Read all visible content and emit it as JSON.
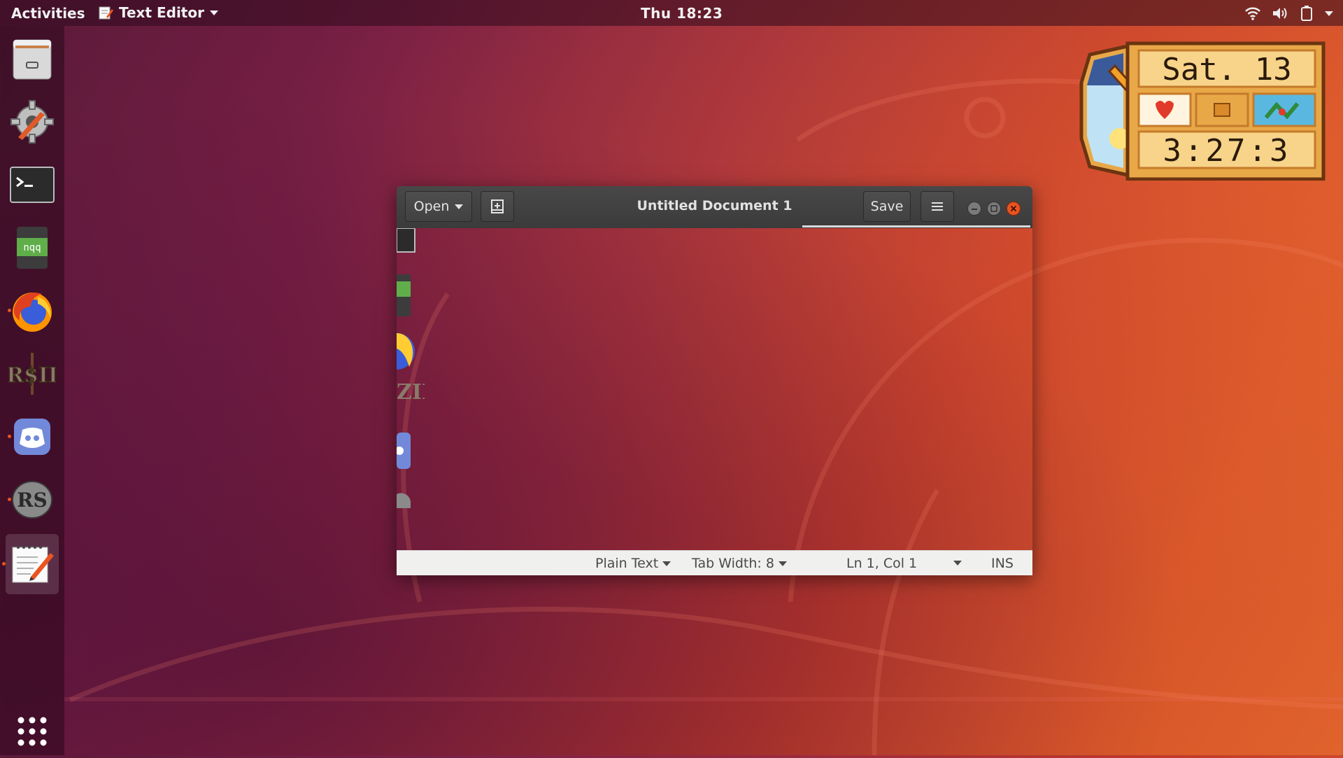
{
  "topbar": {
    "activities": "Activities",
    "app_name": "Text Editor",
    "clock": "Thu 18:23"
  },
  "dock": {
    "items": [
      {
        "name": "files",
        "running": false
      },
      {
        "name": "software-updater",
        "running": false
      },
      {
        "name": "terminal",
        "running": false
      },
      {
        "name": "nqq",
        "label": "nqq",
        "running": false
      },
      {
        "name": "firefox",
        "running": true
      },
      {
        "name": "runescape",
        "label": "R$II",
        "running": false
      },
      {
        "name": "discord",
        "running": true
      },
      {
        "name": "runelite",
        "label": "RS",
        "running": true
      },
      {
        "name": "text-editor",
        "running": true,
        "active": true
      }
    ],
    "show_apps": "show-applications"
  },
  "window": {
    "open_label": "Open",
    "title": "Untitled Document 1",
    "save_label": "Save"
  },
  "statusbar": {
    "language": "Plain Text",
    "tab_width": "Tab Width: 8",
    "position": "Ln 1, Col 1",
    "mode": "INS"
  },
  "widget": {
    "date": "Sat. 13",
    "time": "3:27:3"
  },
  "colors": {
    "accent": "#e95420",
    "headerbar": "#3f3f3f",
    "statusbar": "#f0f0ef",
    "close": "#e95420"
  }
}
